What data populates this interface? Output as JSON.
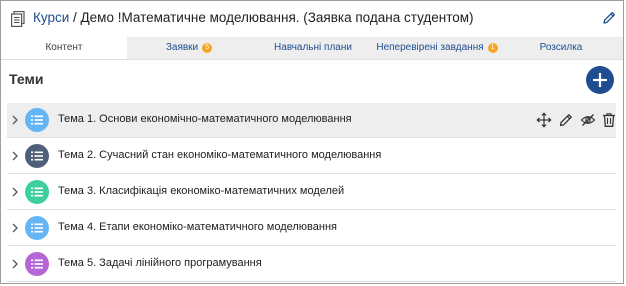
{
  "header": {
    "breadcrumb_root": "Курси",
    "separator": " / ",
    "title": "Демо !Математичне моделювання. (Заявка подана студентом)"
  },
  "tabs": [
    {
      "label": "Контент",
      "active": true,
      "badge": null
    },
    {
      "label": "Заявки",
      "active": false,
      "badge": "5"
    },
    {
      "label": "Навчальні плани",
      "active": false,
      "badge": null
    },
    {
      "label": "Неперевірені завдання",
      "active": false,
      "badge": "1"
    },
    {
      "label": "Розсилка",
      "active": false,
      "badge": null
    }
  ],
  "section_title": "Теми",
  "topics": [
    {
      "label": "Тема 1. Основи економічно-математичного моделювання",
      "color": "#64b5f6",
      "highlighted": true
    },
    {
      "label": "Тема 2. Сучасний стан економіко-математичного моделювання",
      "color": "#4f5f7a",
      "highlighted": false
    },
    {
      "label": "Тема 3. Класифікація економіко-математичних моделей",
      "color": "#3ecf9e",
      "highlighted": false
    },
    {
      "label": "Тема 4. Етапи економіко-математичного моделювання",
      "color": "#64b5f6",
      "highlighted": false
    },
    {
      "label": "Тема 5. Задачі лінійного програмування",
      "color": "#b566d6",
      "highlighted": false
    }
  ],
  "colors": {
    "accent": "#1e4d92",
    "badge": "#f5a623",
    "tab_bar": "#eeeeee"
  },
  "icons": {
    "header": "document-icon",
    "edit": "pencil-icon",
    "add": "plus-icon",
    "row_actions": [
      "move-icon",
      "pencil-icon",
      "eye-off-icon",
      "trash-icon"
    ]
  }
}
